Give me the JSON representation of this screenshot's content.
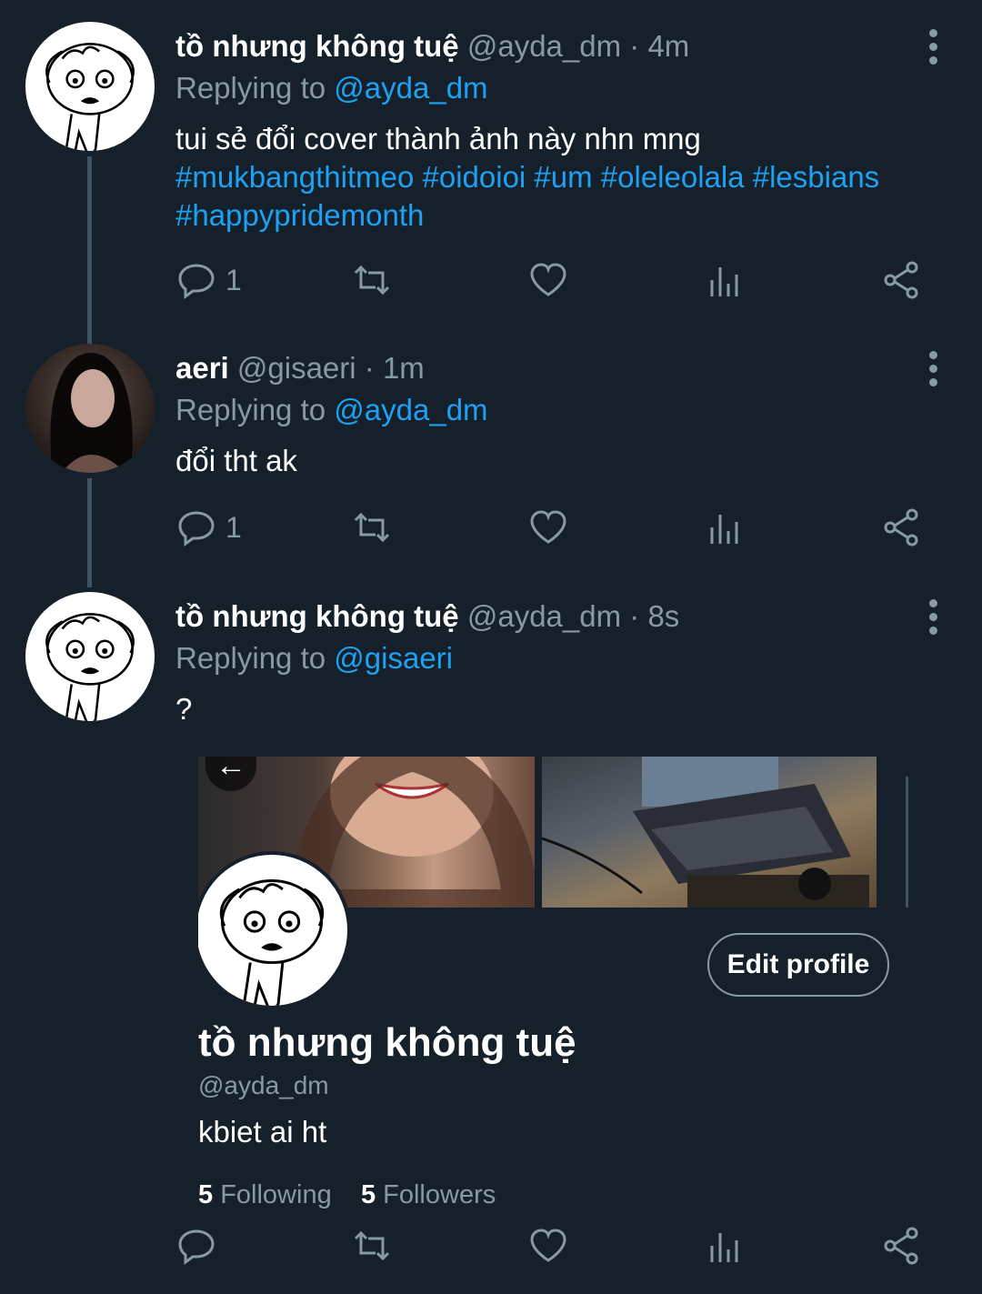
{
  "tweets": [
    {
      "name": "tồ nhưng không tuệ",
      "handle": "@ayda_dm",
      "time": "· 4m",
      "replying_prefix": "Replying to",
      "replying_to": "@ayda_dm",
      "text": "tui sẻ đổi cover thành ảnh này nhn mng",
      "hashtags": "#mukbangthitmeo #oidoioi #um #oleleolala #lesbians #happypridemonth",
      "reply_count": "1"
    },
    {
      "name": "aeri",
      "handle": "@gisaeri",
      "time": "· 1m",
      "replying_prefix": "Replying to",
      "replying_to": "@ayda_dm",
      "text": "đổi tht ak",
      "reply_count": "1"
    },
    {
      "name": "tồ nhưng không tuệ",
      "handle": "@ayda_dm",
      "time": "· 8s",
      "replying_prefix": "Replying to",
      "replying_to": "@gisaeri",
      "text": "?",
      "reply_count": ""
    }
  ],
  "profile_card": {
    "back_glyph": "←",
    "edit_label": "Edit profile",
    "name": "tồ nhưng không tuệ",
    "handle": "@ayda_dm",
    "bio": "kbiet ai ht",
    "following_count": "5",
    "following_label": "Following",
    "followers_count": "5",
    "followers_label": "Followers"
  },
  "icons": {
    "reply": "reply-icon",
    "retweet": "retweet-icon",
    "like": "heart-icon",
    "stats": "analytics-icon",
    "share": "share-icon",
    "more": "more-vertical-icon"
  },
  "colors": {
    "background": "#15202b",
    "accent": "#1da1f2",
    "muted": "#8899a6"
  }
}
